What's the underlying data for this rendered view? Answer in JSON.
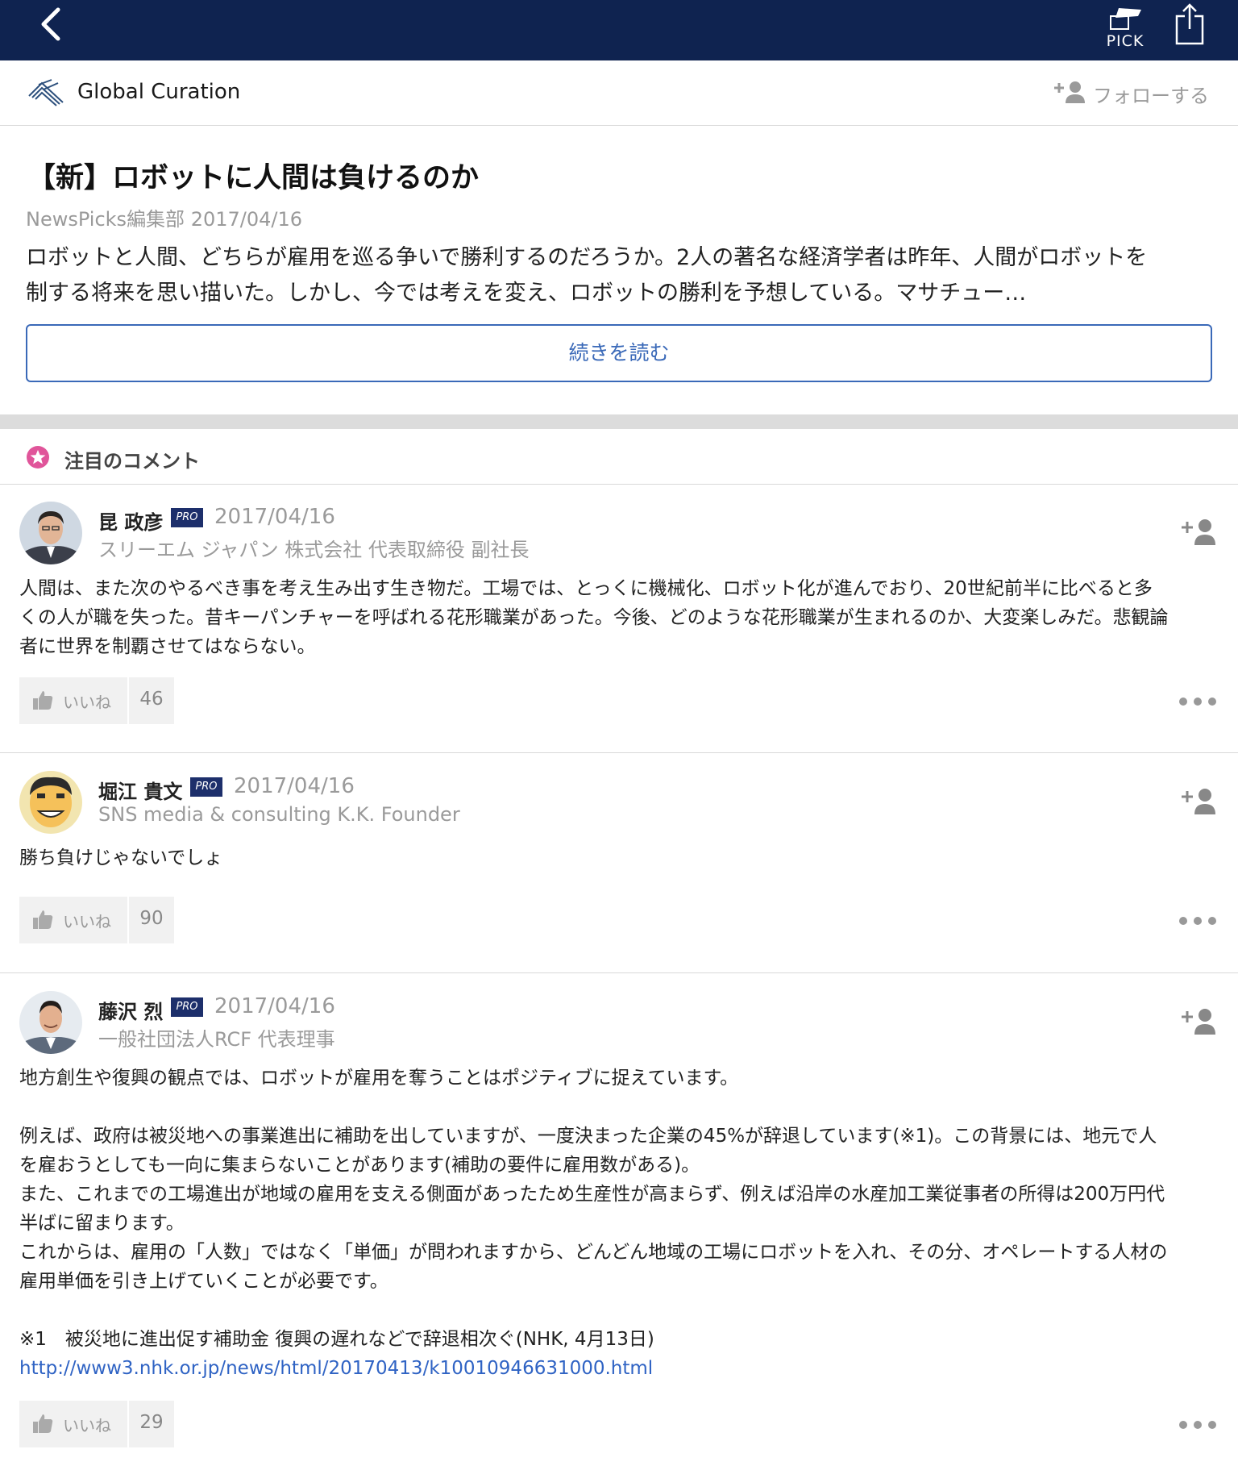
{
  "header": {
    "back_icon": "chevron-left-icon",
    "pick_label": "PICK",
    "pick_icon": "pick-flag-icon",
    "share_icon": "share-icon",
    "background": "#0f2350"
  },
  "source": {
    "name": "Global Curation",
    "follow_label": "フォローする"
  },
  "article": {
    "title": "【新】ロボットに人間は負けるのか",
    "meta": "NewsPicks編集部 2017/04/16",
    "lead_lines": [
      "ロボットと人間、どちらが雇用を巡る争いで勝利するのだろうか。2人の著名な経済学者は昨年、人間がロボットを",
      "制する将来を思い描いた。しかし、今では考えを変え、ロボットの勝利を予想している。マサチュー…"
    ],
    "read_more": "続きを読む"
  },
  "section": {
    "title": "注目のコメント"
  },
  "comments": [
    {
      "name": "昆 政彦",
      "badge": "PRO",
      "date": "2017/04/16",
      "role": "スリーエム ジャパン 株式会社 代表取締役 副社長",
      "lines": [
        "人間は、また次のやるべき事を考え生み出す生き物だ。工場では、とっくに機械化、ロボット化が進んでおり、20世紀前半に比べると多",
        "くの人が職を失った。昔キーパンチャーを呼ばれる花形職業があった。今後、どのような花形職業が生まれるのか、大変楽しみだ。悲観論",
        "者に世界を制覇させてはならない。"
      ],
      "like_label": "いいね",
      "likes": "46"
    },
    {
      "name": "堀江 貴文",
      "badge": "PRO",
      "date": "2017/04/16",
      "role": "SNS media & consulting K.K. Founder",
      "lines": [
        "勝ち負けじゃないでしょ"
      ],
      "like_label": "いいね",
      "likes": "90"
    },
    {
      "name": "藤沢 烈",
      "badge": "PRO",
      "date": "2017/04/16",
      "role": "一般社団法人RCF 代表理事",
      "lines": [
        "地方創生や復興の観点では、ロボットが雇用を奪うことはポジティブに捉えています。",
        "",
        "例えば、政府は被災地への事業進出に補助を出していますが、一度決まった企業の45%が辞退しています(※1)。この背景には、地元で人",
        "を雇おうとしても一向に集まらないことがあります(補助の要件に雇用数がある)。",
        "また、これまでの工場進出が地域の雇用を支える側面があったため生産性が高まらず、例えば沿岸の水産加工業従事者の所得は200万円代",
        "半ばに留まります。",
        "これからは、雇用の「人数」ではなく「単価」が問われますから、どんどん地域の工場にロボットを入れ、その分、オペレートする人材の",
        "雇用単価を引き上げていくことが必要です。",
        "",
        "※1　被災地に進出促す補助金 復興の遅れなどで辞退相次ぐ(NHK, 4月13日)"
      ],
      "link": "http://www3.nhk.or.jp/news/html/20170413/k10010946631000.html",
      "like_label": "いいね",
      "likes": "29"
    }
  ],
  "colors": {
    "accent": "#3a69b8",
    "pro_badge": "#1d2f6b",
    "link": "#2f63c4",
    "star": "#e0559a"
  }
}
